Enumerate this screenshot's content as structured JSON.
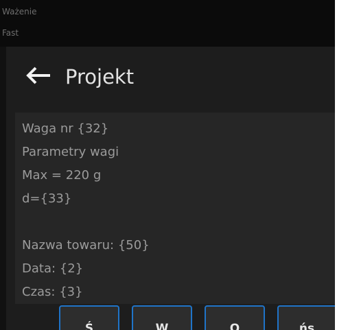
{
  "status_bar": {
    "mode": "Ważenie",
    "profile": "Fast"
  },
  "header": {
    "title": "Projekt",
    "back_icon": "arrow-left-icon"
  },
  "content": {
    "lines": [
      "Waga nr {32}",
      "Parametry wagi",
      "Max = 220 g",
      "d={33}",
      "Nazwa towaru: {50}",
      "Data: {2}",
      "Czas: {3}"
    ]
  },
  "keyboard": {
    "keys": [
      "Ś",
      "W",
      "O",
      "ńs"
    ]
  },
  "colors": {
    "background": "#111111",
    "panel": "#1d1d1d",
    "content_box": "#262626",
    "key_border": "#1f74c9",
    "title_text": "#e3e3e3",
    "content_text": "#9b9b9b"
  }
}
